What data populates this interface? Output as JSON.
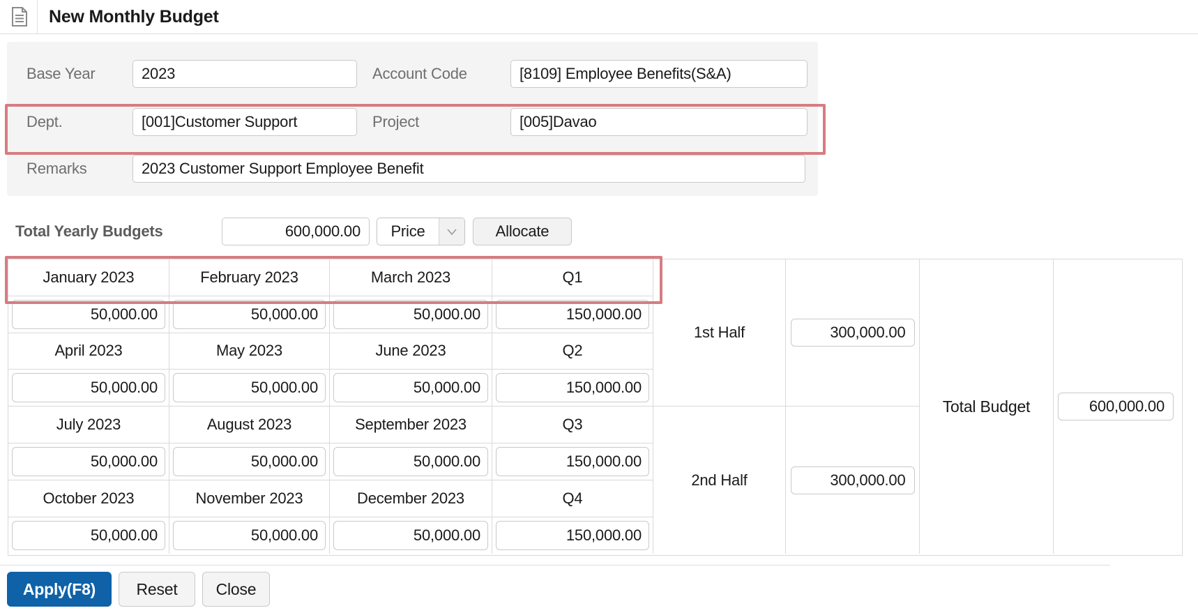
{
  "window": {
    "title": "New Monthly Budget"
  },
  "form": {
    "base_year": {
      "label": "Base Year",
      "value": "2023"
    },
    "account_code": {
      "label": "Account Code",
      "value": "[8109] Employee Benefits(S&A)"
    },
    "dept": {
      "label": "Dept.",
      "value": "[001]Customer Support"
    },
    "project": {
      "label": "Project",
      "value": "[005]Davao"
    },
    "remarks": {
      "label": "Remarks",
      "value": "2023 Customer Support Employee Benefit"
    }
  },
  "yearly": {
    "label": "Total Yearly Budgets",
    "amount": "600,000.00",
    "type_selected": "Price",
    "allocate_label": "Allocate"
  },
  "table": {
    "groups": [
      {
        "months": [
          "January 2023",
          "February 2023",
          "March 2023"
        ],
        "values": [
          "50,000.00",
          "50,000.00",
          "50,000.00"
        ],
        "quarter": {
          "label": "Q1",
          "value": "150,000.00"
        }
      },
      {
        "months": [
          "April 2023",
          "May 2023",
          "June 2023"
        ],
        "values": [
          "50,000.00",
          "50,000.00",
          "50,000.00"
        ],
        "quarter": {
          "label": "Q2",
          "value": "150,000.00"
        }
      },
      {
        "months": [
          "July 2023",
          "August 2023",
          "September 2023"
        ],
        "values": [
          "50,000.00",
          "50,000.00",
          "50,000.00"
        ],
        "quarter": {
          "label": "Q3",
          "value": "150,000.00"
        }
      },
      {
        "months": [
          "October 2023",
          "November 2023",
          "December 2023"
        ],
        "values": [
          "50,000.00",
          "50,000.00",
          "50,000.00"
        ],
        "quarter": {
          "label": "Q4",
          "value": "150,000.00"
        }
      }
    ],
    "halves": [
      {
        "label": "1st Half",
        "value": "300,000.00"
      },
      {
        "label": "2nd Half",
        "value": "300,000.00"
      }
    ],
    "total": {
      "label": "Total Budget",
      "value": "600,000.00"
    }
  },
  "footer": {
    "apply_label": "Apply(F8)",
    "reset_label": "Reset",
    "close_label": "Close"
  },
  "colors": {
    "highlight_red": "#d67d82",
    "accent_blue": "#0f62a8"
  }
}
